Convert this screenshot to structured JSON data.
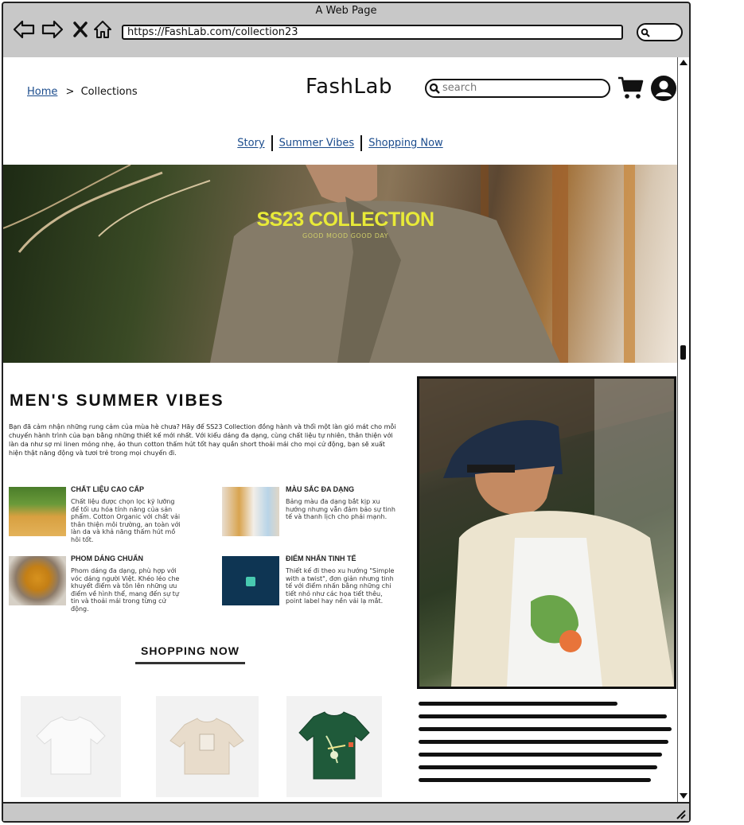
{
  "browser": {
    "title": "A Web Page",
    "url": "https://FashLab.com/collection23"
  },
  "breadcrumb": {
    "home": "Home",
    "separator": ">",
    "current": "Collections"
  },
  "brand": "FashLab",
  "search": {
    "placeholder": "search"
  },
  "nav": {
    "items": [
      "Story",
      "Summer Vibes",
      "Shopping Now"
    ]
  },
  "hero": {
    "title": "SS23 COLLECTION",
    "subtitle": "GOOD MOOD GOOD DAY"
  },
  "section": {
    "title": "MEN'S SUMMER VIBES",
    "body": "Bạn đã cảm nhận những rung cảm của mùa hè chưa? Hãy để SS23 Collection đồng hành và thổi một làn gió mát cho mỗi chuyến hành trình của bạn bằng những thiết kế mới nhất. Với kiểu dáng đa dạng, cùng chất liệu tự nhiên, thân thiện với làn da như sợ mi linen mỏng nhẹ, áo thun cotton thấm hút tốt hay quần short thoải mái cho mọi cử động, bạn sẽ xuất hiện thật năng động và tươi trẻ trong mọi chuyến đi."
  },
  "features": [
    {
      "title": "CHẤT LIỆU CAO CẤP",
      "text": "Chất liệu được chọn lọc kỹ lưỡng để tối ưu hóa tính năng của sản phẩm. Cotton Organic với chất vải thân thiện môi trường, an toàn với làn da và khả năng thấm hút mồ hôi tốt."
    },
    {
      "title": "MÀU SẮC ĐA DẠNG",
      "text": "Bảng màu đa dạng bắt kịp xu hướng nhưng vẫn đảm bảo sự tinh tế và thanh lịch cho phái mạnh."
    },
    {
      "title": "PHOM DÁNG CHUẨN",
      "text": "Phom dáng đa dạng, phù hợp với vóc dáng người Việt. Khéo léo che khuyết điểm và tôn lên những ưu điểm về hình thể, mang đến sự tự tin và thoải mái trong từng cử động."
    },
    {
      "title": "ĐIỂM NHẤN TINH TẾ",
      "text": "Thiết kế đi theo xu hướng \"Simple with a twist\", đơn giản nhưng tinh tế với điểm nhấn bằng những chi tiết nhỏ như các họa tiết thêu, point label hay nền vải lạ mắt."
    }
  ],
  "shopping": {
    "heading": "SHOPPING NOW"
  },
  "colors": {
    "hero_title": "#e8ea38",
    "link": "#1a4b8c",
    "chrome": "#c8c8c8"
  }
}
